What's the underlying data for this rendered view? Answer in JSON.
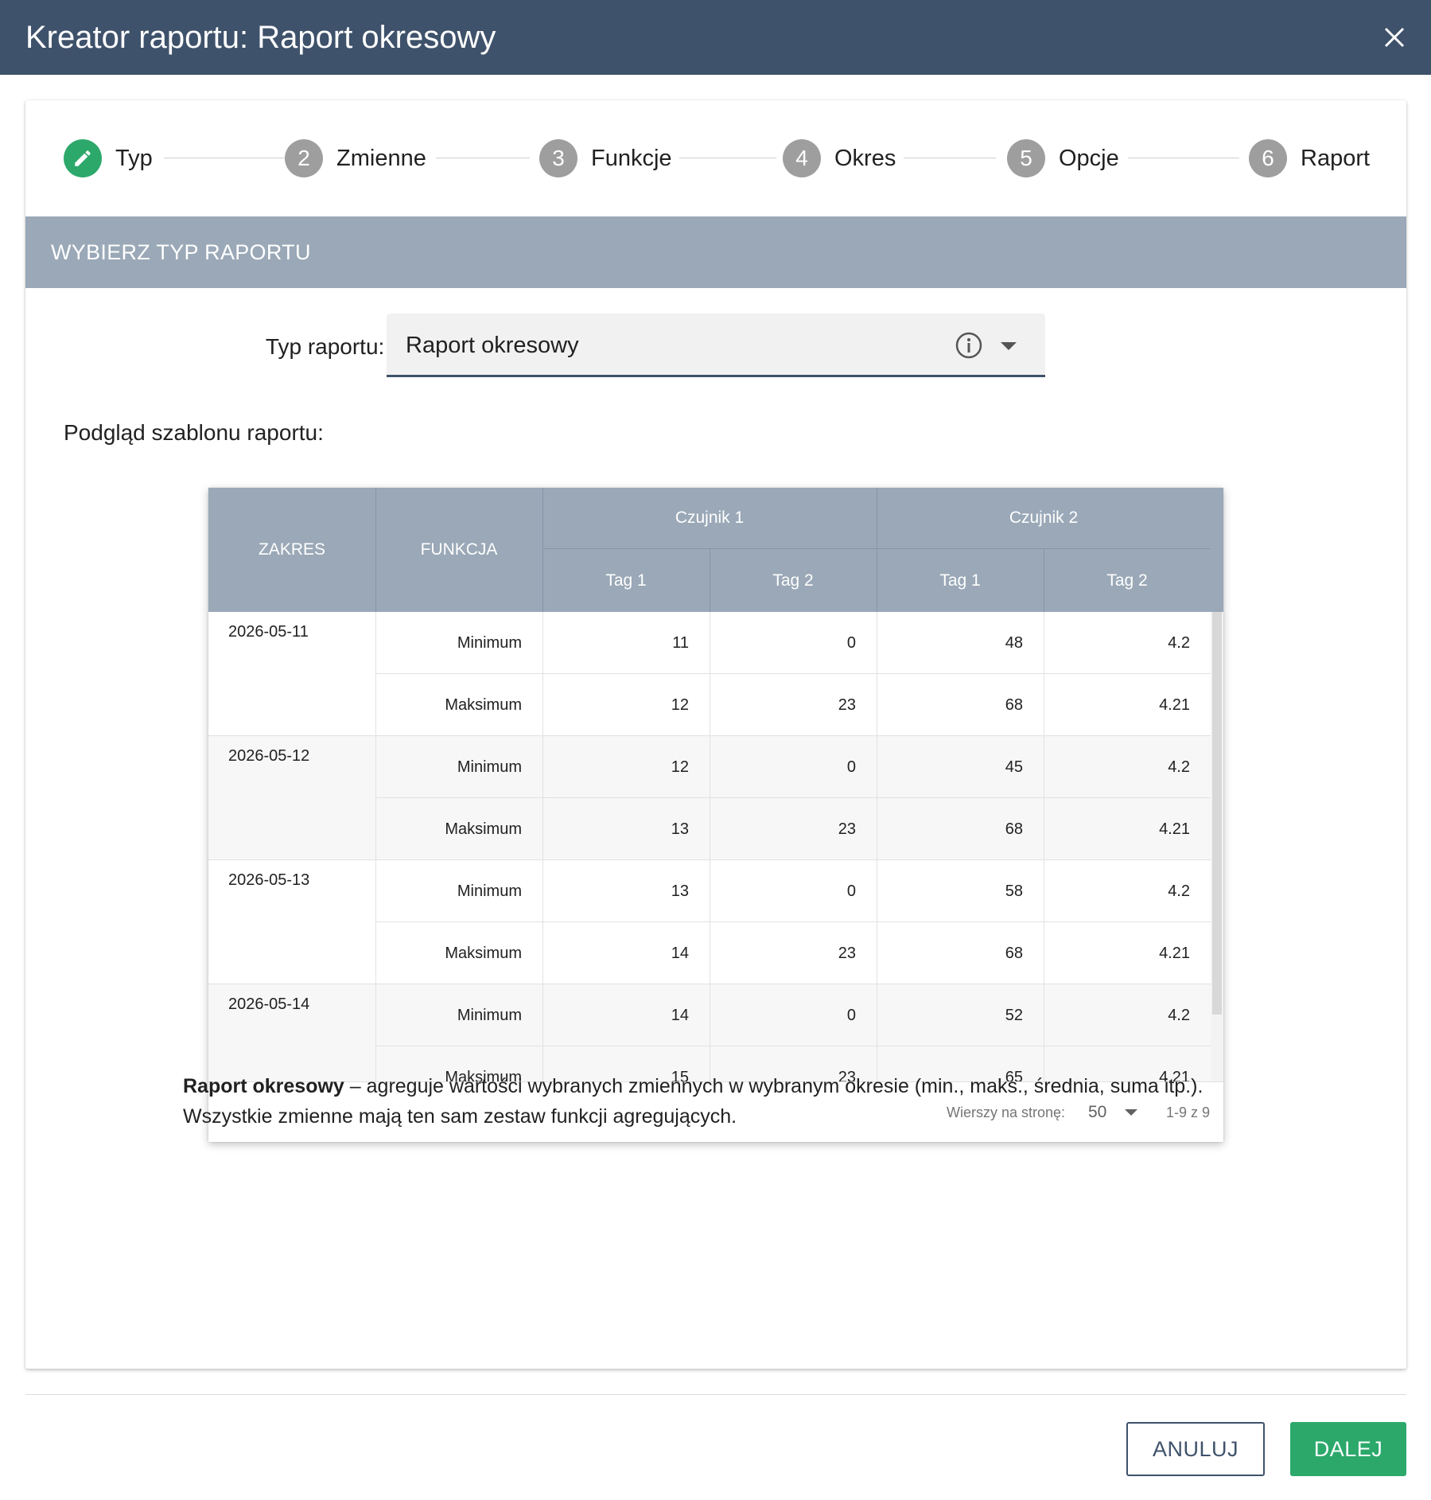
{
  "window": {
    "title": "Kreator raportu: Raport okresowy"
  },
  "stepper": {
    "steps": [
      {
        "number": "",
        "label": "Typ",
        "state": "active-edit"
      },
      {
        "number": "2",
        "label": "Zmienne"
      },
      {
        "number": "3",
        "label": "Funkcje"
      },
      {
        "number": "4",
        "label": "Okres"
      },
      {
        "number": "5",
        "label": "Opcje"
      },
      {
        "number": "6",
        "label": "Raport"
      }
    ]
  },
  "section": {
    "title": "WYBIERZ TYP RAPORTU"
  },
  "report_type": {
    "label": "Typ raportu: *",
    "value": "Raport okresowy"
  },
  "preview": {
    "label": "Podgląd szablonu raportu:",
    "headers": {
      "range": "ZAKRES",
      "function": "FUNKCJA",
      "sensor1": "Czujnik 1",
      "sensor2": "Czujnik 2",
      "tag1": "Tag 1",
      "tag2": "Tag 2"
    },
    "groups": [
      {
        "date": "2026-05-11",
        "rows": [
          {
            "fn": "Minimum",
            "v": [
              "11",
              "0",
              "48",
              "4.2"
            ]
          },
          {
            "fn": "Maksimum",
            "v": [
              "12",
              "23",
              "68",
              "4.21"
            ]
          }
        ]
      },
      {
        "date": "2026-05-12",
        "rows": [
          {
            "fn": "Minimum",
            "v": [
              "12",
              "0",
              "45",
              "4.2"
            ]
          },
          {
            "fn": "Maksimum",
            "v": [
              "13",
              "23",
              "68",
              "4.21"
            ]
          }
        ]
      },
      {
        "date": "2026-05-13",
        "rows": [
          {
            "fn": "Minimum",
            "v": [
              "13",
              "0",
              "58",
              "4.2"
            ]
          },
          {
            "fn": "Maksimum",
            "v": [
              "14",
              "23",
              "68",
              "4.21"
            ]
          }
        ]
      },
      {
        "date": "2026-05-14",
        "rows": [
          {
            "fn": "Minimum",
            "v": [
              "14",
              "0",
              "52",
              "4.2"
            ]
          },
          {
            "fn": "Maksimum",
            "v": [
              "15",
              "23",
              "65",
              "4.21"
            ]
          }
        ]
      }
    ],
    "footer": {
      "rows_per_page_label": "Wierszy na stronę:",
      "rows_per_page": "50",
      "range": "1-9 z 9"
    }
  },
  "description": {
    "bold": "Raport okresowy",
    "text": " – agreguje wartości wybranych zmiennych w wybranym okresie (min., maks., średnia, suma itp.).",
    "text2": "Wszystkie zmienne mają ten sam zestaw funkcji agregujących."
  },
  "actions": {
    "cancel": "ANULUJ",
    "next": "DALEJ"
  },
  "colors": {
    "header": "#3f526b",
    "section": "#9aa8b7",
    "accent": "#2ca86b"
  },
  "icons": {
    "close": "close-icon",
    "edit": "pencil-icon",
    "info": "info-icon",
    "dropdown": "caret-down-icon"
  }
}
